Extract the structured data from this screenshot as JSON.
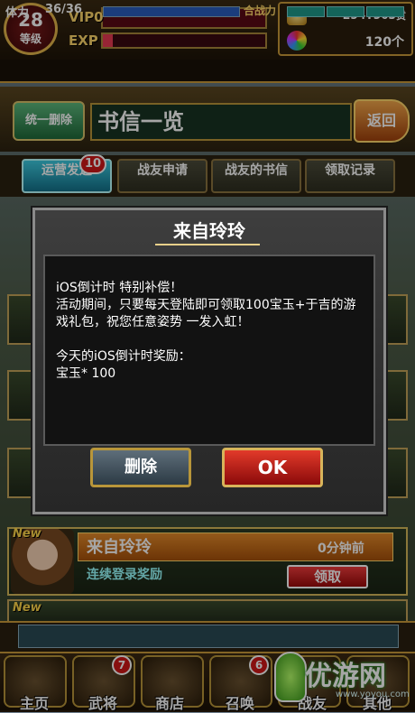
{
  "status": {
    "level": "28",
    "level_label": "等级",
    "vip": "VIP0",
    "exp_label": "EXP",
    "exp_progress": 0.06,
    "gold": "254.563",
    "gold_unit": "贯",
    "gems": "120个",
    "stamina_label": "体力",
    "stamina": "36/36",
    "power_label": "合战力"
  },
  "header": {
    "delete_all": "统一删除",
    "title": "书信一览",
    "back": "返回"
  },
  "tabs": [
    {
      "label": "运营发送",
      "badge": "10"
    },
    {
      "label": "战友申请"
    },
    {
      "label": "战友的书信"
    },
    {
      "label": "领取记录"
    }
  ],
  "list": [
    {
      "new": "New",
      "from": "来自玲玲",
      "time": "0分钟前",
      "subject": "连续登录奖励",
      "action": "领取"
    },
    {
      "new": "New"
    }
  ],
  "dialog": {
    "title": "来自玲玲",
    "lines": [
      "iOS倒计时 特别补偿！",
      "活动期间，只要每天登陆即可领取100宝玉+于吉的游戏礼包，祝您任意姿势 一发入虹！",
      "今天的iOS倒计时奖励：",
      "宝玉* 100"
    ],
    "delete": "删除",
    "ok": "OK"
  },
  "nav": [
    {
      "label": "主页"
    },
    {
      "label": "武将",
      "badge": "7"
    },
    {
      "label": "商店"
    },
    {
      "label": "召唤",
      "badge": "6"
    },
    {
      "label": "战友"
    },
    {
      "label": "其他"
    }
  ],
  "watermark": {
    "text": "优游网",
    "url": "www.yoyou.com"
  },
  "colors": {
    "accent_tab": "#13718a",
    "ok": "#e23a2a",
    "claim": "#f03c3c",
    "row_highlight": "#e38a2a"
  }
}
